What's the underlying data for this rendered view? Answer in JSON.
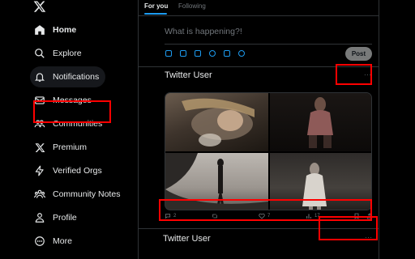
{
  "sidebar": {
    "items": [
      {
        "label": "Home",
        "icon": "home-icon",
        "bold": true
      },
      {
        "label": "Explore",
        "icon": "search-icon"
      },
      {
        "label": "Notifications",
        "icon": "bell-icon"
      },
      {
        "label": "Messages",
        "icon": "mail-icon"
      },
      {
        "label": "Communities",
        "icon": "people-icon"
      },
      {
        "label": "Premium",
        "icon": "x-logo-icon"
      },
      {
        "label": "Verified Orgs",
        "icon": "lightning-icon"
      },
      {
        "label": "Community Notes",
        "icon": "community-notes-icon"
      },
      {
        "label": "Profile",
        "icon": "person-icon"
      },
      {
        "label": "More",
        "icon": "more-circle-icon"
      }
    ]
  },
  "tabs": [
    {
      "label": "For you",
      "active": true
    },
    {
      "label": "Following",
      "active": false
    }
  ],
  "composer": {
    "placeholder": "What is happening?!",
    "post_label": "Post",
    "tools": [
      "image-icon",
      "gif-icon",
      "poll-icon",
      "emoji-icon",
      "schedule-icon",
      "location-icon"
    ]
  },
  "tweets": [
    {
      "user": "Twitter User",
      "more": "···",
      "stats": {
        "replies": "2",
        "retweets": "",
        "likes": "7",
        "views": "17",
        "bookmark": ""
      }
    },
    {
      "user": "Twitter User",
      "more": "···"
    }
  ],
  "colors": {
    "accent": "#1d9bf0",
    "highlight": "#ff0000",
    "border": "#2f3336"
  }
}
